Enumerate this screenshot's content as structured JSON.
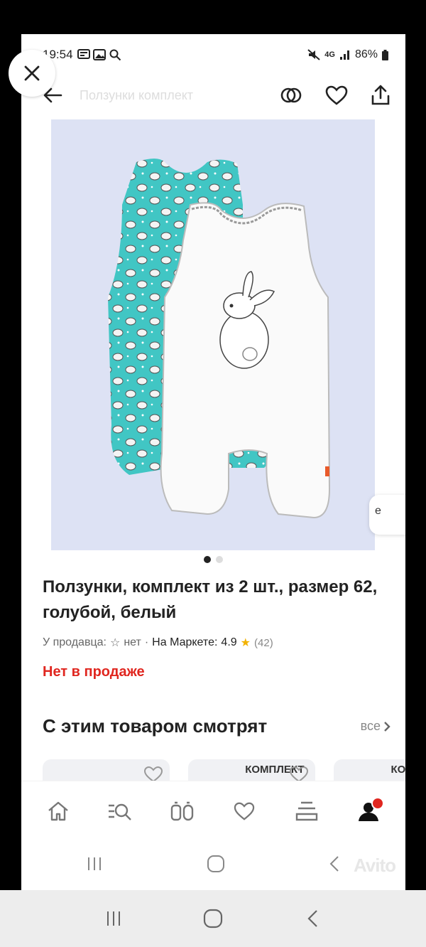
{
  "status_bar": {
    "time": "19:54",
    "network": "4G",
    "battery": "86%"
  },
  "top_bar": {
    "title": "Ползунки комплект"
  },
  "product": {
    "side_label": "е",
    "title": "Ползунки, комплект из 2 шт., размер 62, голубой, белый",
    "seller_label": "У продавца:",
    "seller_rating": "нет",
    "market_label": "На Маркете:",
    "market_rating": "4.9",
    "reviews": "(42)",
    "availability": "Нет в продаже",
    "gallery_total": 2,
    "gallery_active": 1
  },
  "related": {
    "heading": "С этим товаром смотрят",
    "all_label": "все",
    "cards": [
      {
        "label": ""
      },
      {
        "label": "КОМПЛЕКТ"
      },
      {
        "label": "КО"
      }
    ]
  },
  "bottom_nav": [
    "home-icon",
    "catalog-search-icon",
    "compare-icon",
    "favorites-icon",
    "cart-icon",
    "profile-icon"
  ],
  "watermark": "Avito",
  "colors": {
    "accent_red": "#e0261f",
    "star_yellow": "#f2b200",
    "photo_bg": "#dde2f4",
    "teal": "#41c6c4"
  }
}
